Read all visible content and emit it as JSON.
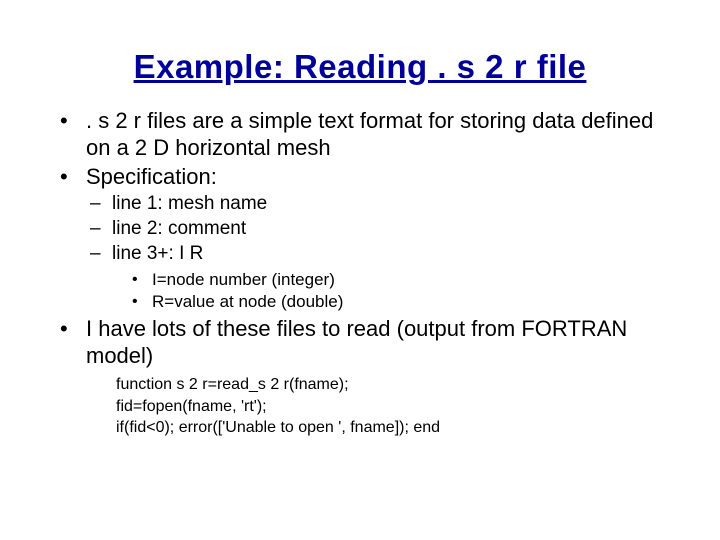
{
  "title": "Example: Reading . s 2 r file",
  "bullets": {
    "b1": ". s 2 r files are a simple text format for storing data defined on a 2 D horizontal mesh",
    "b2": "Specification:",
    "b2_sub": {
      "s1": "line 1: mesh name",
      "s2": "line 2: comment",
      "s3": "line 3+:  I    R",
      "s3_sub": {
        "t1": "I=node number (integer)",
        "t2": "R=value at node (double)"
      }
    },
    "b3": "I have lots of these files to read (output from FORTRAN model)"
  },
  "code": {
    "l1": "function s 2 r=read_s 2 r(fname);",
    "l2": "fid=fopen(fname, 'rt');",
    "l3": "if(fid<0); error(['Unable to open ', fname]); end"
  }
}
